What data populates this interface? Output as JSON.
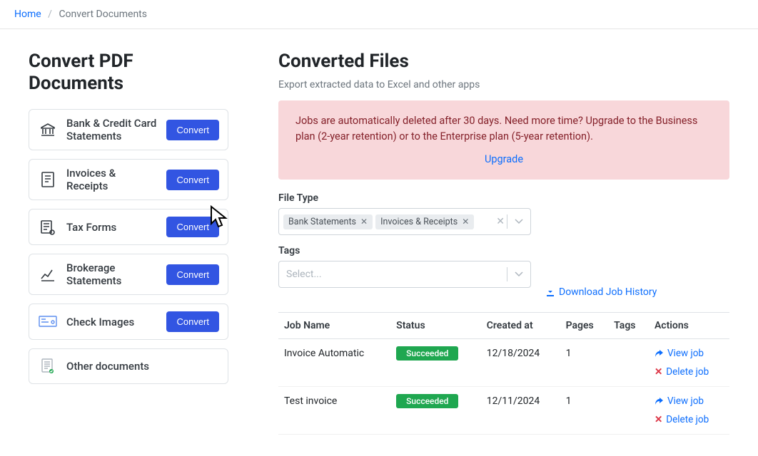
{
  "breadcrumb": {
    "home": "Home",
    "current": "Convert Documents"
  },
  "left": {
    "heading": "Convert PDF Documents",
    "convert_label": "Convert",
    "items": [
      {
        "label": "Bank & Credit Card Statements"
      },
      {
        "label": "Invoices & Receipts"
      },
      {
        "label": "Tax Forms"
      },
      {
        "label": "Brokerage Statements"
      },
      {
        "label": "Check Images"
      },
      {
        "label": "Other documents"
      }
    ]
  },
  "right": {
    "heading": "Converted Files",
    "subtitle": "Export extracted data to Excel and other apps",
    "alert_text": "Jobs are automatically deleted after 30 days. Need more time? Upgrade to the Business plan (2-year retention) or to the Enterprise plan (5-year retention).",
    "upgrade_label": "Upgrade",
    "file_type_label": "File Type",
    "file_type_chips": [
      "Bank Statements",
      "Invoices & Receipts"
    ],
    "tags_label": "Tags",
    "tags_placeholder": "Select...",
    "download_history": "Download Job History",
    "table": {
      "headers": [
        "Job Name",
        "Status",
        "Created at",
        "Pages",
        "Tags",
        "Actions"
      ],
      "rows": [
        {
          "name": "Invoice Automatic",
          "status": "Succeeded",
          "created": "12/18/2024",
          "pages": "1",
          "tags": ""
        },
        {
          "name": "Test invoice",
          "status": "Succeeded",
          "created": "12/11/2024",
          "pages": "1",
          "tags": ""
        }
      ],
      "view_label": "View job",
      "delete_label": "Delete job"
    }
  }
}
